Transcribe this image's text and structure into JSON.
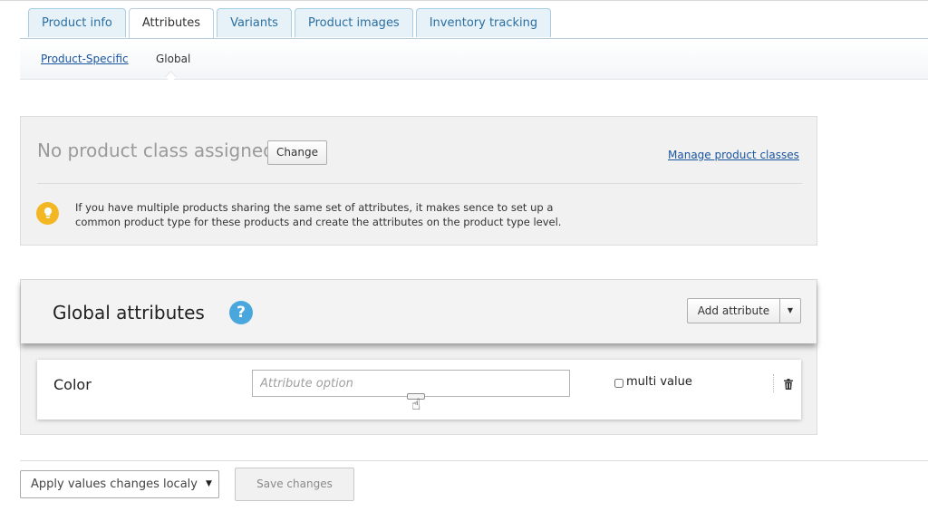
{
  "tabs": [
    {
      "label": "Product info"
    },
    {
      "label": "Attributes"
    },
    {
      "label": "Variants"
    },
    {
      "label": "Product images"
    },
    {
      "label": "Inventory tracking"
    }
  ],
  "active_tab": "Attributes",
  "subtabs": {
    "product_specific": "Product-Specific",
    "global": "Global"
  },
  "product_class": {
    "title": "No product class assigned",
    "change_label": "Change",
    "manage_link": "Manage product classes",
    "hint": "If you have multiple products sharing the same set of attributes, it makes sence to set up a common product type for these products and create the attributes on the product type level.",
    "hint_icon": "lightbulb-icon"
  },
  "global_attributes": {
    "title": "Global attributes",
    "help_glyph": "?",
    "add_label": "Add attribute",
    "rows": [
      {
        "name": "Color",
        "placeholder": "Attribute option",
        "multi_value_label": "multi value",
        "multi_value_checked": false
      }
    ]
  },
  "footer": {
    "apply_select_value": "Apply values changes localy",
    "save_label": "Save changes"
  },
  "colors": {
    "link": "#1a55a0",
    "tab_bg": "#e7f1f8",
    "hint_icon": "#f4b724",
    "help_icon": "#4aa7dd"
  }
}
